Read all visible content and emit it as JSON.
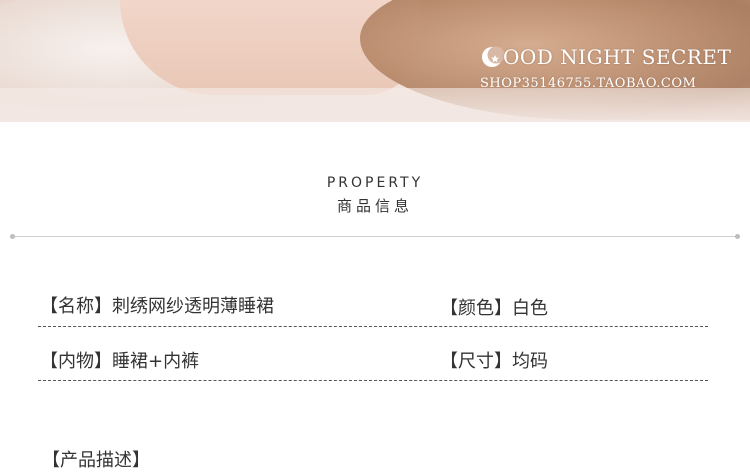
{
  "banner": {
    "brand": "OOD NIGHT SECRET",
    "shop": "SHOP35146755.TAOBAO.COM",
    "moon_icon": "moon-star-icon",
    "colors": {
      "text": "#ffffff"
    }
  },
  "section": {
    "title_en": "PROPERTY",
    "title_cn": "商品信息"
  },
  "properties": [
    {
      "label": "【名称】",
      "value": "刺绣网纱透明薄睡裙"
    },
    {
      "label": "【颜色】",
      "value": "白色"
    },
    {
      "label": "【内物】",
      "value": "睡裙+内裤"
    },
    {
      "label": "【尺寸】",
      "value": "均码"
    }
  ],
  "footer": {
    "partial_text": "【产品描述】"
  }
}
